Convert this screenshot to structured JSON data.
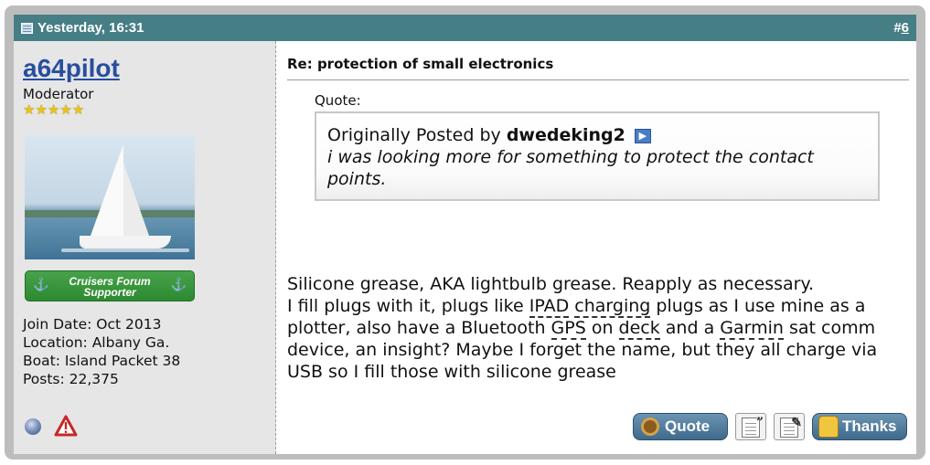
{
  "header": {
    "date": "Yesterday, 16:31",
    "post_number_prefix": "#",
    "post_number": "6"
  },
  "user": {
    "name": "a64pilot",
    "title": "Moderator",
    "stars": 5,
    "supporter_badge": [
      "Cruisers Forum",
      "Supporter"
    ],
    "join_date": "Join Date: Oct 2013",
    "location": "Location: Albany Ga.",
    "boat": "Boat: Island Packet 38",
    "posts": "Posts: 22,375"
  },
  "post": {
    "title": "Re: protection of small electronics",
    "quote_label": "Quote:",
    "quote_prefix": "Originally Posted by",
    "quote_author": "dwedeking2",
    "quote_text": "i was looking more for something to protect the contact points.",
    "message_line1": "Silicone grease, AKA lightbulb grease. Reapply as necessary.",
    "message_parts": [
      "I fill plugs with it, plugs like ",
      "IPAD",
      " ",
      "charging",
      " plugs as I use mine as a plotter, also have a Bluetooth ",
      "GPS",
      " on ",
      "deck",
      " and a ",
      "Garmin",
      " sat comm device, an insight? Maybe I forget the name, but they all charge via USB so I fill those with silicone grease"
    ]
  },
  "buttons": {
    "quote_label": "Quote",
    "thanks_label": "Thanks"
  },
  "colors": {
    "header_bg": "#467e86",
    "username": "#274e9f",
    "supporter_green": "#2d8a31",
    "button_blue": "#3e6a8c"
  }
}
